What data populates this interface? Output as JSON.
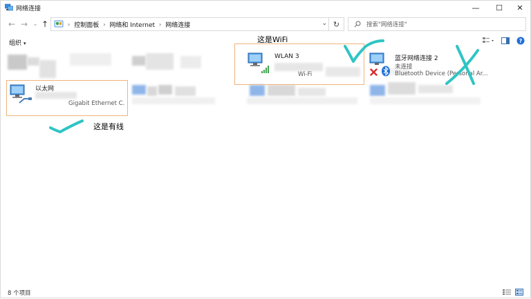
{
  "window": {
    "title": "网络连接",
    "minimize_glyph": "—",
    "maximize_glyph": "☐",
    "close_glyph": "✕"
  },
  "nav": {
    "back_glyph": "←",
    "forward_glyph": "→",
    "recent_glyph": "⌄",
    "up_glyph": "↑"
  },
  "breadcrumb": {
    "items": [
      "控制面板",
      "网络和 Internet",
      "网络连接"
    ],
    "separator": "›"
  },
  "address": {
    "dropdown_glyph": "⌄",
    "refresh_glyph": "↻"
  },
  "search": {
    "placeholder": "搜索\"网络连接\""
  },
  "toolbar": {
    "organize_label": "组织",
    "organize_caret": "▾"
  },
  "connections": [
    {
      "name": "以太网",
      "detail": "Gigabit Ethernet C.",
      "icon": "ethernet-icon",
      "status_icon": "cable-icon",
      "highlighted": true
    },
    {
      "name": "WLAN 3",
      "detail": "Wi-Fi",
      "icon": "wifi-adapter-icon",
      "status_icon": "signal-bars-icon",
      "highlighted": true
    },
    {
      "name": "蓝牙网络连接 2",
      "status": "未连接",
      "detail": "Bluetooth Device (Personal Ar...",
      "icon": "bluetooth-adapter-icon",
      "status_icon": "disconnected-x-icon"
    }
  ],
  "annotations": {
    "wifi_label": "这是WiFi",
    "wired_label": "这是有线"
  },
  "status_bar": {
    "item_count": "8 个项目"
  },
  "colors": {
    "highlight_border": "#f0b37a",
    "annotation_ink": "#2ec4c4",
    "accent_blue": "#1e6fd9",
    "error_red": "#d62b2b"
  }
}
